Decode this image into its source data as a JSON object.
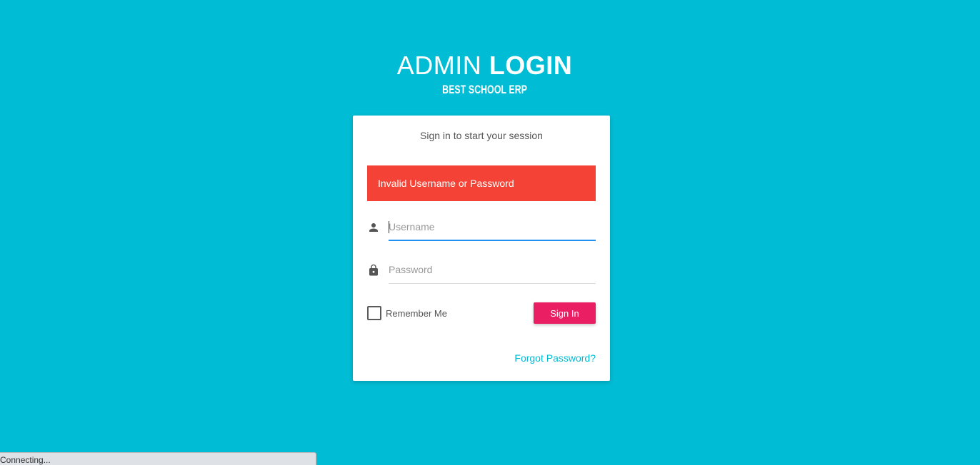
{
  "header": {
    "title_light": "ADMIN",
    "title_bold": "LOGIN",
    "subtitle": "BEST SCHOOL ERP"
  },
  "card": {
    "message": "Sign in to start your session",
    "alert": "Invalid Username or Password"
  },
  "form": {
    "username": {
      "placeholder": "Username",
      "value": "",
      "icon": "person-icon"
    },
    "password": {
      "placeholder": "Password",
      "value": "",
      "icon": "lock-icon"
    },
    "remember_label": "Remember Me",
    "remember_checked": false,
    "signin_label": "Sign In",
    "forgot_label": "Forgot Password?"
  },
  "status_bar": {
    "text": "Connecting..."
  },
  "colors": {
    "background": "#00bcd4",
    "alert": "#f44336",
    "button": "#e91e63",
    "link": "#00bcd4",
    "focus_line": "#1f91f3"
  }
}
